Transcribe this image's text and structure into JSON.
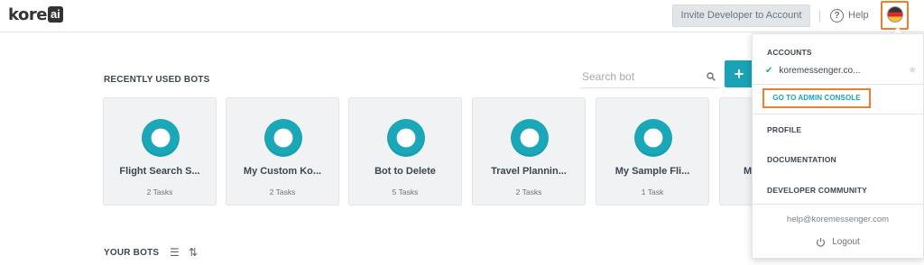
{
  "header": {
    "logo_text": "kore",
    "logo_box": "ai",
    "invite_label": "Invite Developer to Account",
    "help_label": "Help"
  },
  "recent": {
    "title": "RECENTLY USED BOTS",
    "search_placeholder": "Search bot",
    "add_label": "+"
  },
  "bots": [
    {
      "name": "Flight Search S...",
      "tasks": "2 Tasks"
    },
    {
      "name": "My Custom Ko...",
      "tasks": "2 Tasks"
    },
    {
      "name": "Bot to Delete",
      "tasks": "5 Tasks"
    },
    {
      "name": "Travel Plannin...",
      "tasks": "2 Tasks"
    },
    {
      "name": "My Sample Fli...",
      "tasks": "1 Task"
    },
    {
      "name": "M",
      "tasks": ""
    }
  ],
  "your_bots": {
    "title": "YOUR BOTS"
  },
  "dropdown": {
    "accounts_heading": "ACCOUNTS",
    "account_name": "koremessenger.co...",
    "admin_console": "GO TO ADMIN CONSOLE",
    "profile": "PROFILE",
    "documentation": "DOCUMENTATION",
    "developer_community": "DEVELOPER COMMUNITY",
    "email": "help@koremessenger.com",
    "logout": "Logout"
  },
  "colors": {
    "accent": "#18a3b6",
    "highlight": "#f07d2b"
  }
}
